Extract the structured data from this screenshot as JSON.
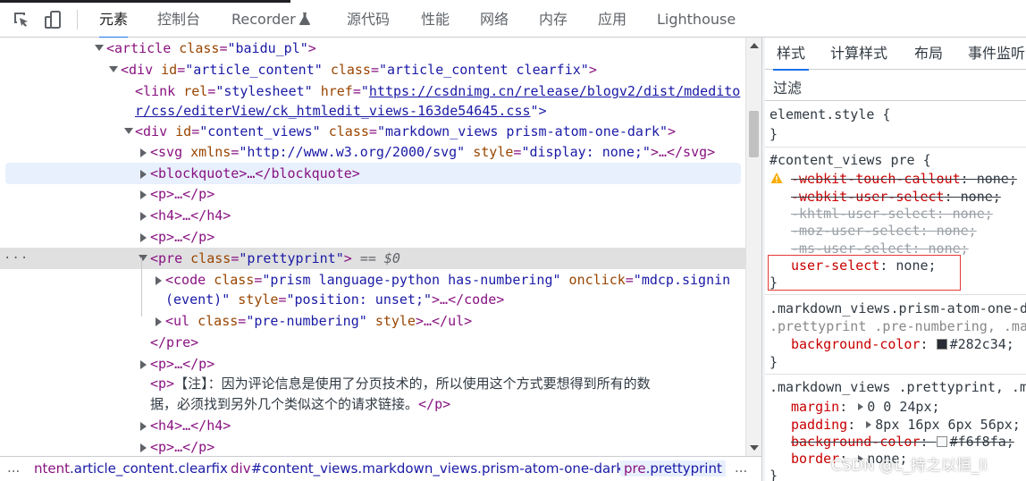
{
  "toolbar": {
    "tabs": [
      "元素",
      "控制台",
      "Recorder",
      "源代码",
      "性能",
      "网络",
      "内存",
      "应用",
      "Lighthouse"
    ]
  },
  "dom": {
    "l1": {
      "open": "<",
      "tag": "article",
      "sp": " ",
      "a1": "class",
      "eq": "=",
      "v1": "\"baidu_pl\"",
      "close": ">"
    },
    "l2": {
      "tag": "div",
      "a1": "id",
      "v1": "\"article_content\"",
      "a2": "class",
      "v2": "\"article_content clearfix\""
    },
    "l3": {
      "tag": "link",
      "a1": "rel",
      "v1": "\"stylesheet\"",
      "a2": "href",
      "q": "\"",
      "href1": "https://csdnimg.cn/release/blogv2/dist/mdedito",
      "href2": "r/css/editerView/ck_htmledit_views-163de54645.css",
      "end": "\">"
    },
    "l4": {
      "tag": "div",
      "a1": "id",
      "v1": "\"content_views\"",
      "a2": "class",
      "v2": "\"markdown_views prism-atom-one-dark\""
    },
    "l5": {
      "tag": "svg",
      "a1": "xmlns",
      "v1": "\"http://www.w3.org/2000/svg\"",
      "a2": "style",
      "v2": "\"display: none;\"",
      "ellipsis": ">…</svg>"
    },
    "l6": "<blockquote>…</blockquote>",
    "l7": "<p>…</p>",
    "l8": "<h4>…</h4>",
    "l9": "<p>…</p>",
    "l10": {
      "tag": "pre",
      "a1": "class",
      "v1": "\"prettyprint\"",
      "eqdollar": "== $0"
    },
    "l11": {
      "tag": "code",
      "a1": "class",
      "v1": "\"prism language-python has-numbering\"",
      "a2": "onclick",
      "v2a": "\"mdcp.signin",
      "v2b": "(event)\"",
      "a3": "style",
      "v3": "\"position: unset;\"",
      "ellipsis": ">…</code>"
    },
    "l12": {
      "tag": "ul",
      "a1": "class",
      "v1": "\"pre-numbering\"",
      "a2": "style",
      "ellipsis": ">…</ul>"
    },
    "l13": "</pre>",
    "l14": "<p>…</p>",
    "l15": {
      "open": "<p>",
      "text1": "【注】：因为评论信息是使用了分页技术的，所以使用这个方式要想得到所有的数",
      "text2": "据，必须找到另外几个类似这个的请求链接。",
      "close": "</p>"
    },
    "l16": "<h4>…</h4>",
    "l17": "<p>…</p>",
    "dots": "···"
  },
  "breadcrumb": {
    "c1_el": "ntent",
    "c1_rest": ".article_content.clearfix",
    "c2_el": "div",
    "c2_rest": "#content_views.markdown_views.prism-atom-one-dark",
    "c3_el": "pre",
    "c3_rest": ".prettyprint",
    "dots_left": "...",
    "dots_right": "..."
  },
  "styles": {
    "tabs": [
      "样式",
      "计算样式",
      "布局",
      "事件监听"
    ],
    "filter_placeholder": "过滤",
    "r1": {
      "selector": "element.style",
      "open": " {",
      "close": "}"
    },
    "r2": {
      "selector": "#content_views pre",
      "open": " {",
      "props": [
        {
          "name": "-webkit-touch-callout",
          "value": "none;"
        },
        {
          "name": "-webkit-user-select",
          "value": "none;"
        },
        {
          "name": "-khtml-user-select",
          "value": "none;"
        },
        {
          "name": "-moz-user-select",
          "value": "none;"
        },
        {
          "name": "-ms-user-select",
          "value": "none;"
        },
        {
          "name": "user-select",
          "value": "none;"
        }
      ],
      "close": "}"
    },
    "r3": {
      "selector1": ".markdown_views.prism-atom-one-d",
      "selector2": ".prettyprint .pre-numbering, .ma",
      "prop": "background-color",
      "value": "#282c34;",
      "swatch": "#282c34",
      "close": "}"
    },
    "r4": {
      "selector": ".markdown_views .prettyprint, .m",
      "margin_name": "margin",
      "margin_value": "0 0 24px;",
      "padding_name": "padding",
      "padding_value": "8px 16px 6px 56px;",
      "bg_name": "background-color",
      "bg_value": "#f6f8fa;",
      "bg_swatch": "#f6f8fa",
      "border_name": "border",
      "border_value": "none;",
      "close": "}"
    },
    "colon": ": "
  },
  "watermark": "CSDN @L_持之以恒_li"
}
